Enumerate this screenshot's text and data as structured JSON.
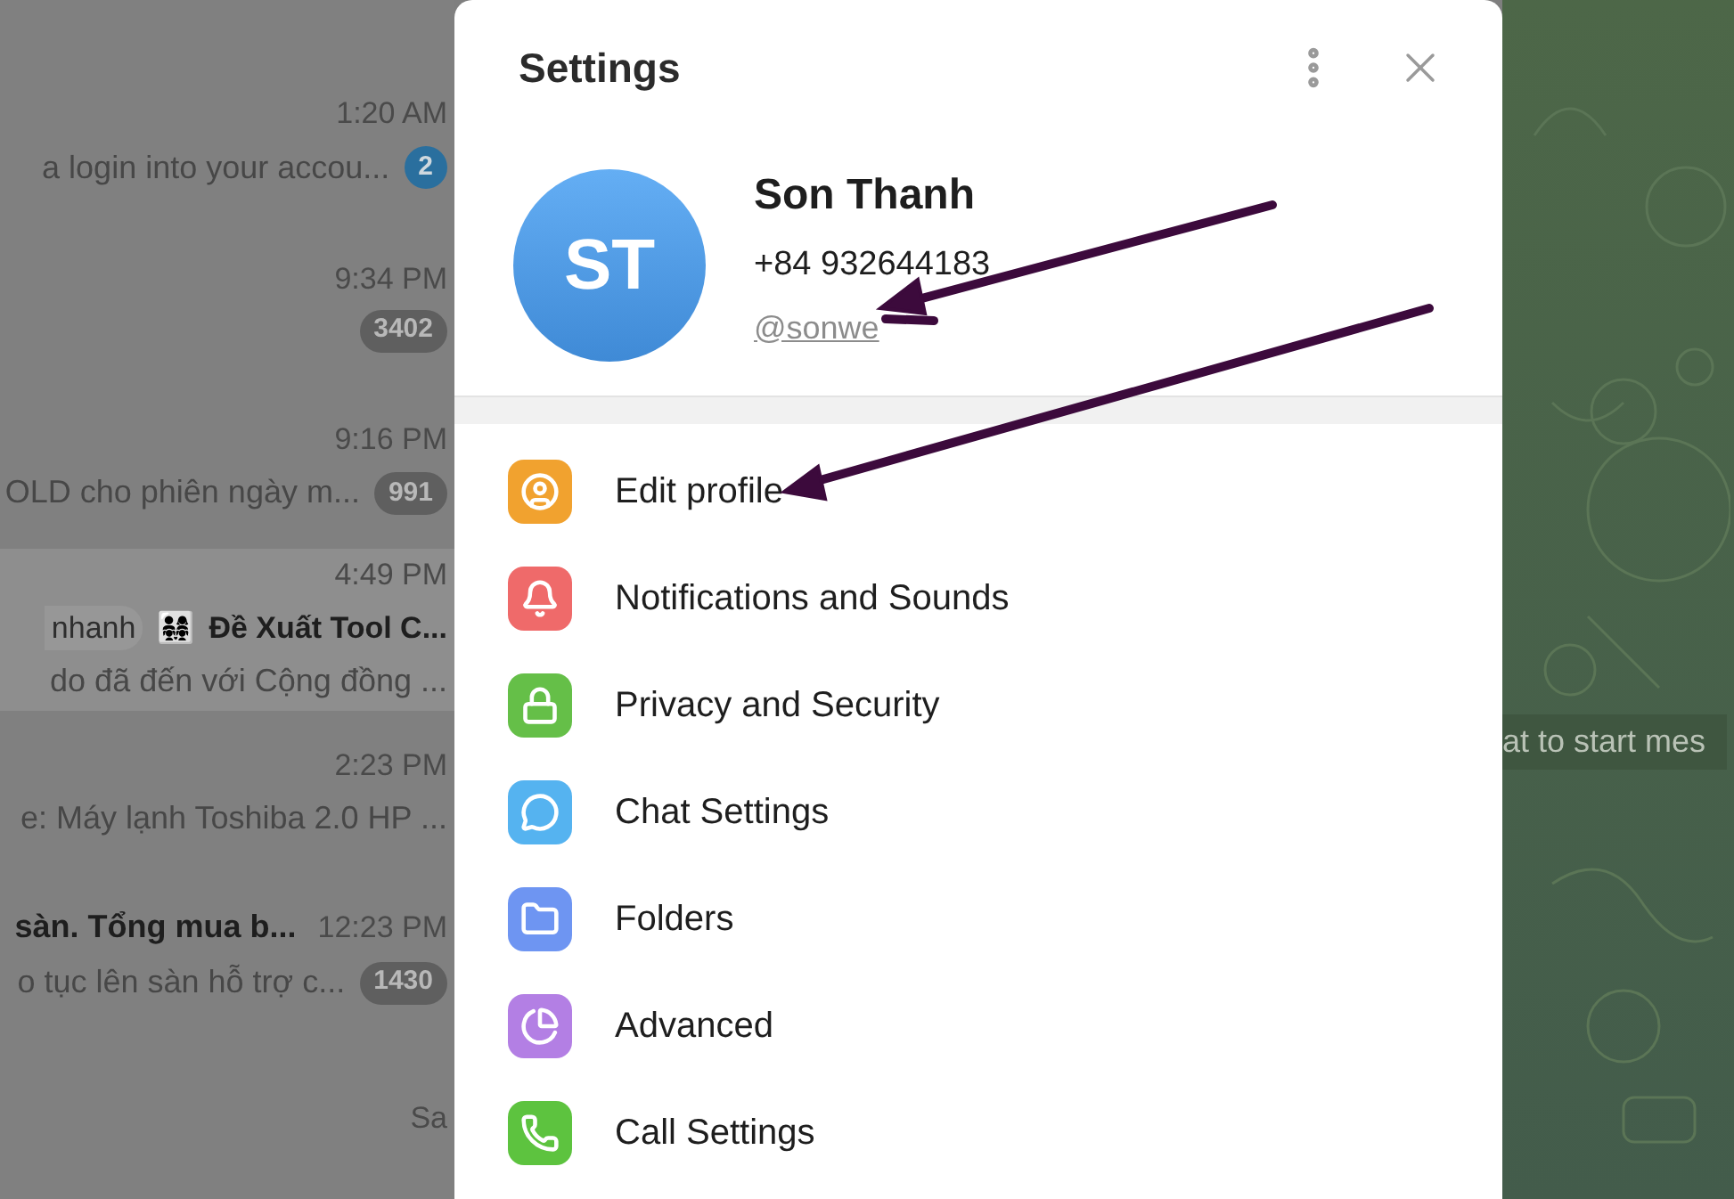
{
  "chat_list": [
    {
      "time": "1:20 AM",
      "preview": "a login into your accou...",
      "badge": "2",
      "muted": false
    },
    {
      "time": "9:34 PM",
      "badge": "3402",
      "muted": true
    },
    {
      "time": "9:16 PM",
      "preview": "OLD cho phiên ngày m...",
      "badge": "991",
      "muted": true
    },
    {
      "time": "4:49 PM",
      "tag": "nhanh",
      "emoji": "👨‍👩‍👧‍👧",
      "title": "Đề Xuất Tool C...",
      "preview": "do đã đến với Cộng đồng ...",
      "highlighted": true
    },
    {
      "time": "2:23 PM",
      "preview": "e: Máy lạnh Toshiba 2.0 HP ..."
    },
    {
      "title": "sàn. Tổng mua b...",
      "time": "12:23 PM",
      "preview": "o tục lên sàn hỗ trợ c...",
      "badge": "1430",
      "muted": true
    },
    {
      "time": "Sa"
    }
  ],
  "settings": {
    "title": "Settings",
    "profile": {
      "initials": "ST",
      "name": "Son Thanh",
      "phone": "+84 932644183",
      "username": "@sonwe"
    },
    "items": [
      {
        "label": "Edit profile",
        "color": "#f1a22f"
      },
      {
        "label": "Notifications and Sounds",
        "color": "#ef6a6a"
      },
      {
        "label": "Privacy and Security",
        "color": "#65bf48"
      },
      {
        "label": "Chat Settings",
        "color": "#55b3f0"
      },
      {
        "label": "Folders",
        "color": "#6e95f2"
      },
      {
        "label": "Advanced",
        "color": "#b37fe4"
      },
      {
        "label": "Call Settings",
        "color": "#5dc33f"
      }
    ]
  },
  "chat_area": {
    "hint": "at to start mes"
  }
}
